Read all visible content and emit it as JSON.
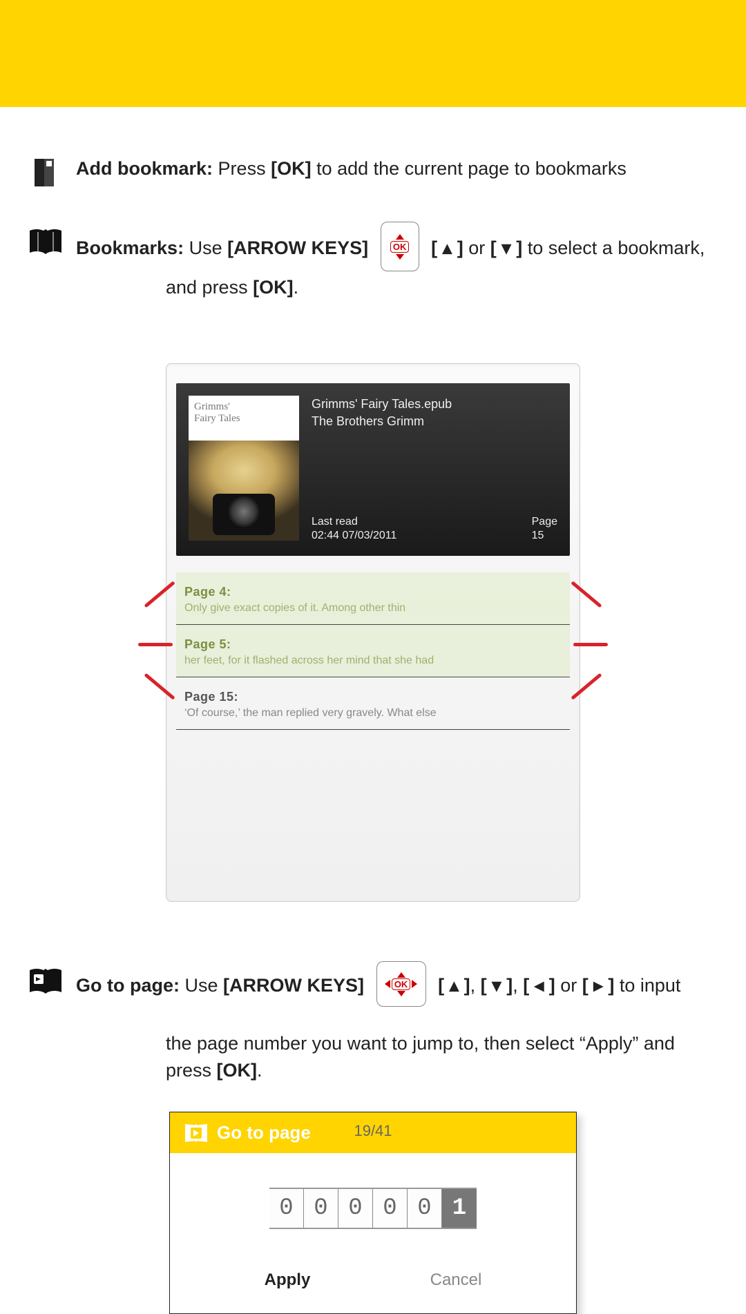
{
  "header": {},
  "sections": {
    "add_bookmark": {
      "title": "Add bookmark:",
      "text_1": "Press ",
      "key_ok": "[OK]",
      "text_2": " to add the current page to bookmarks"
    },
    "bookmarks": {
      "title": "Bookmarks:",
      "text_1": "Use ",
      "key_arrows": "[ARROW KEYS]",
      "text_up": "[ ▴ ]",
      "text_or": " or ",
      "text_down": "[ ▾ ]",
      "text_2": " to select a bookmark,",
      "text_3": "and press ",
      "key_ok": "[OK]",
      "text_3_end": "."
    },
    "goto": {
      "title": "Go to page:",
      "text_1": "Use ",
      "key_arrows": "[ARROW KEYS]",
      "k_up": "[ ▴ ]",
      "k_comma1": ", ",
      "k_down": "[ ▾ ]",
      "k_comma2": ", ",
      "k_left": "[ ◂ ]",
      "k_or": " or ",
      "k_right": "[ ▸ ]",
      "text_2": " to input",
      "text_3": "the page number you want to jump to, then select “Apply” and press ",
      "key_ok": "[OK]",
      "text_3_end": "."
    }
  },
  "device_screenshot": {
    "book": {
      "cover_label_1": "Grimms'",
      "cover_label_2": "Fairy Tales",
      "filename": "Grimms' Fairy Tales.epub",
      "author": "The Brothers Grimm",
      "last_read_label": "Last read",
      "last_read_value": "02:44 07/03/2011",
      "page_label": "Page",
      "page_value": "15"
    },
    "bookmarks": [
      {
        "page": "Page 4:",
        "excerpt": "Only give exact copies of it. Among other thin",
        "highlight": true
      },
      {
        "page": "Page 5:",
        "excerpt": "her feet, for it flashed across her mind that she had",
        "highlight": true
      },
      {
        "page": "Page 15:",
        "excerpt": "‘Of course,’ the man replied very gravely. What else",
        "highlight": false
      }
    ]
  },
  "goto_dialog": {
    "title": "Go to page",
    "digits": [
      "0",
      "0",
      "0",
      "0",
      "0",
      "1"
    ],
    "apply": "Apply",
    "cancel": "Cancel"
  },
  "page_number": "19/41",
  "ok_label": "OK"
}
